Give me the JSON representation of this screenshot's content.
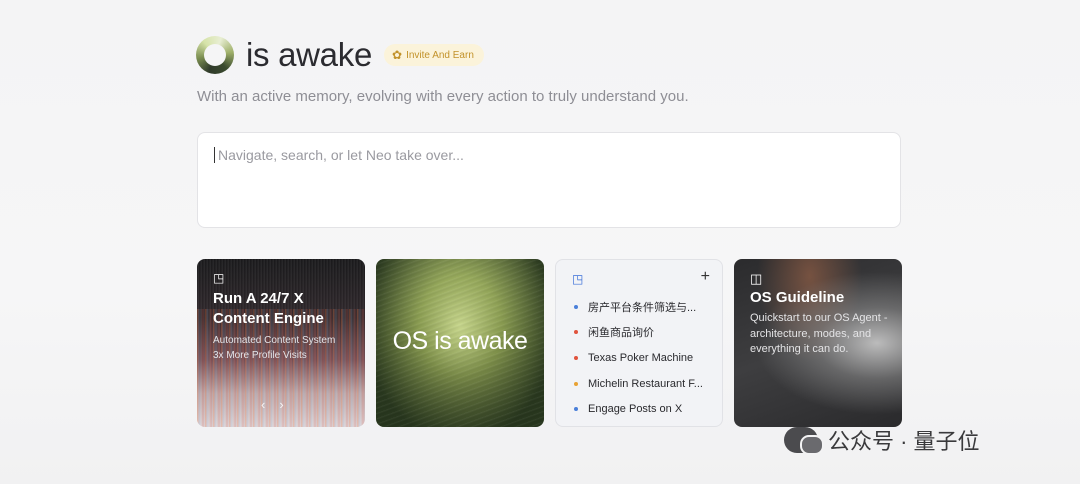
{
  "header": {
    "title": "is awake",
    "invite_label": "Invite And Earn",
    "subtitle": "With an active memory, evolving with every action to truly understand you."
  },
  "search": {
    "placeholder": "Navigate, search, or let Neo take over...",
    "value": ""
  },
  "cards": {
    "content_engine": {
      "title": "Run A 24/7 X Content Engine",
      "subtitle_line1": "Automated Content System",
      "subtitle_line2": "3x More Profile Visits",
      "prev_glyph": "‹",
      "next_glyph": "›"
    },
    "hero": {
      "text": "OS is awake"
    },
    "tasks": {
      "items": [
        {
          "label": "房产平台条件筛选与...",
          "color": "#4a7fd9"
        },
        {
          "label": "闲鱼商品询价",
          "color": "#e0533d"
        },
        {
          "label": "Texas Poker Machine",
          "color": "#e0533d"
        },
        {
          "label": "Michelin Restaurant F...",
          "color": "#e8a234"
        },
        {
          "label": "Engage Posts on X",
          "color": "#4a7fd9"
        }
      ]
    },
    "guideline": {
      "title": "OS Guideline",
      "description": "Quickstart to our OS Agent - architecture, modes, and everything it can do."
    }
  },
  "watermark": {
    "text": "公众号 · 量子位"
  },
  "icons": {
    "logo": "ring-logo",
    "gift": "gift-icon",
    "note": "note-icon",
    "plus": "plus-icon",
    "book": "book-icon"
  }
}
